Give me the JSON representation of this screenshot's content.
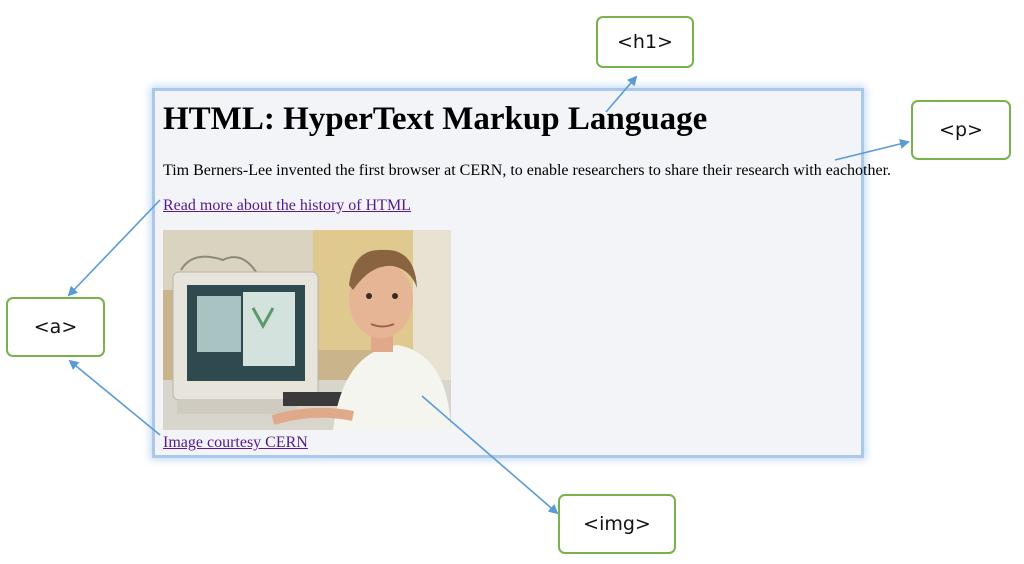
{
  "page": {
    "heading": "HTML: HyperText Markup Language",
    "paragraph": "Tim Berners-Lee invented the first browser at CERN, to enable researchers to share their research with eachother.",
    "history_link": "Read more about the history of HTML",
    "credit_link": "Image courtesy CERN"
  },
  "callouts": {
    "h1": "<h1>",
    "p": "<p>",
    "a": "<a>",
    "img": "<img>"
  },
  "colors": {
    "callout_border": "#77b24c",
    "arrow": "#5b9bd5",
    "page_border": "#a9c8ea",
    "link": "#551a8b"
  }
}
